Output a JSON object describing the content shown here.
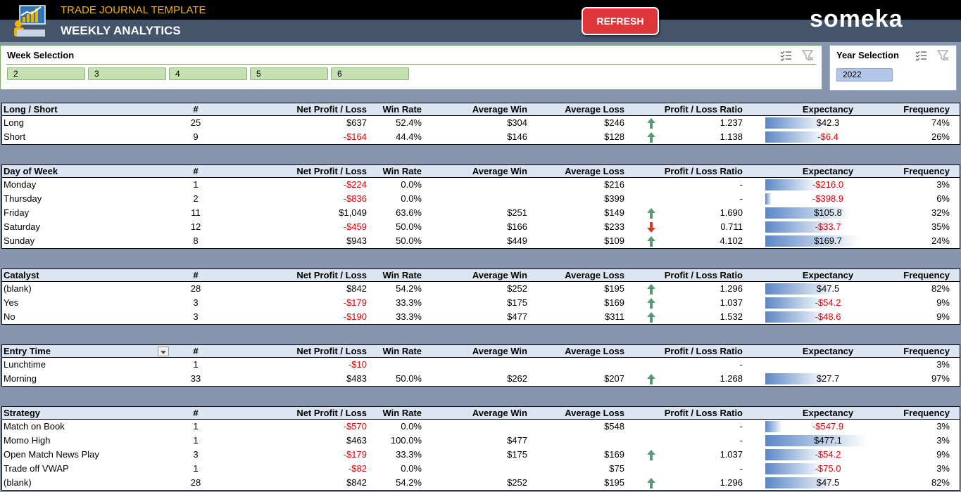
{
  "header": {
    "subtitle": "TRADE JOURNAL TEMPLATE",
    "title": "WEEKLY ANALYTICS",
    "refresh_label": "REFRESH",
    "brand": "someka"
  },
  "week_slicer": {
    "title": "Week Selection",
    "items": [
      "2",
      "3",
      "4",
      "5",
      "6"
    ]
  },
  "year_slicer": {
    "title": "Year Selection",
    "items": [
      "2022"
    ]
  },
  "colors": {
    "positive_arrow": "#5a9a73",
    "negative_arrow": "#d04020",
    "negative_text": "#e00000",
    "bar": "#5b87c7"
  },
  "columns": [
    "#",
    "Net Profit / Loss",
    "Win Rate",
    "Average Win",
    "Average Loss",
    "Profit / Loss Ratio",
    "Expectancy",
    "Frequency"
  ],
  "tables": [
    {
      "title": "Long / Short",
      "rows": [
        {
          "name": "Long",
          "count": "25",
          "np": "$637",
          "np_neg": false,
          "wr": "52.4%",
          "aw": "$304",
          "al": "$246",
          "arrow": "up",
          "plr": "1.237",
          "exp": "$42.3",
          "exp_neg": false,
          "exp_frac": 0.5,
          "freq": "74%"
        },
        {
          "name": "Short",
          "count": "9",
          "np": "-$164",
          "np_neg": true,
          "wr": "44.4%",
          "aw": "$146",
          "al": "$128",
          "arrow": "up",
          "plr": "1.138",
          "exp": "-$6.4",
          "exp_neg": true,
          "exp_frac": 0.5,
          "freq": "26%"
        }
      ]
    },
    {
      "title": "Day of Week",
      "rows": [
        {
          "name": "Monday",
          "count": "1",
          "np": "-$224",
          "np_neg": true,
          "wr": "0.0%",
          "aw": "",
          "al": "$216",
          "arrow": "",
          "plr": "-",
          "exp": "-$216.0",
          "exp_neg": true,
          "exp_frac": 0.44,
          "freq": "3%"
        },
        {
          "name": "Thursday",
          "count": "2",
          "np": "-$836",
          "np_neg": true,
          "wr": "0.0%",
          "aw": "",
          "al": "$399",
          "arrow": "",
          "plr": "-",
          "exp": "-$398.9",
          "exp_neg": true,
          "exp_frac": 0.05,
          "freq": "6%"
        },
        {
          "name": "Friday",
          "count": "11",
          "np": "$1,049",
          "np_neg": false,
          "wr": "63.6%",
          "aw": "$251",
          "al": "$149",
          "arrow": "up",
          "plr": "1.690",
          "exp": "$105.8",
          "exp_neg": false,
          "exp_frac": 0.72,
          "freq": "32%"
        },
        {
          "name": "Saturday",
          "count": "12",
          "np": "-$459",
          "np_neg": true,
          "wr": "50.0%",
          "aw": "$166",
          "al": "$233",
          "arrow": "down",
          "plr": "0.711",
          "exp": "-$33.7",
          "exp_neg": true,
          "exp_frac": 0.6,
          "freq": "35%"
        },
        {
          "name": "Sunday",
          "count": "8",
          "np": "$943",
          "np_neg": false,
          "wr": "50.0%",
          "aw": "$449",
          "al": "$109",
          "arrow": "up",
          "plr": "4.102",
          "exp": "$169.7",
          "exp_neg": false,
          "exp_frac": 0.78,
          "freq": "24%"
        }
      ]
    },
    {
      "title": "Catalyst",
      "rows": [
        {
          "name": "(blank)",
          "count": "28",
          "np": "$842",
          "np_neg": false,
          "wr": "54.2%",
          "aw": "$252",
          "al": "$195",
          "arrow": "up",
          "plr": "1.296",
          "exp": "$47.5",
          "exp_neg": false,
          "exp_frac": 0.59,
          "freq": "82%"
        },
        {
          "name": "Yes",
          "count": "3",
          "np": "-$179",
          "np_neg": true,
          "wr": "33.3%",
          "aw": "$175",
          "al": "$169",
          "arrow": "up",
          "plr": "1.037",
          "exp": "-$54.2",
          "exp_neg": true,
          "exp_frac": 0.5,
          "freq": "9%"
        },
        {
          "name": "No",
          "count": "3",
          "np": "-$190",
          "np_neg": true,
          "wr": "33.3%",
          "aw": "$477",
          "al": "$311",
          "arrow": "up",
          "plr": "1.532",
          "exp": "-$48.6",
          "exp_neg": true,
          "exp_frac": 0.52,
          "freq": "9%"
        }
      ]
    },
    {
      "title": "Entry Time",
      "has_dropdown": true,
      "rows": [
        {
          "name": "Lunchtime",
          "count": "1",
          "np": "-$10",
          "np_neg": true,
          "wr": "",
          "aw": "",
          "al": "",
          "arrow": "",
          "plr": "-",
          "exp": "",
          "exp_neg": false,
          "exp_frac": 0,
          "freq": "3%"
        },
        {
          "name": "Morning",
          "count": "33",
          "np": "$483",
          "np_neg": false,
          "wr": "50.0%",
          "aw": "$262",
          "al": "$207",
          "arrow": "up",
          "plr": "1.268",
          "exp": "$27.7",
          "exp_neg": false,
          "exp_frac": 0.5,
          "freq": "97%"
        }
      ]
    },
    {
      "title": "Strategy",
      "rows": [
        {
          "name": "Match on Book",
          "count": "1",
          "np": "-$570",
          "np_neg": true,
          "wr": "0.0%",
          "aw": "",
          "al": "$548",
          "arrow": "",
          "plr": "-",
          "exp": "-$547.9",
          "exp_neg": true,
          "exp_frac": 0.14,
          "freq": "3%"
        },
        {
          "name": "Momo High",
          "count": "1",
          "np": "$463",
          "np_neg": false,
          "wr": "100.0%",
          "aw": "$477",
          "al": "",
          "arrow": "",
          "plr": "-",
          "exp": "$477.1",
          "exp_neg": false,
          "exp_frac": 0.85,
          "freq": "3%"
        },
        {
          "name": "Open Match News Play",
          "count": "3",
          "np": "-$179",
          "np_neg": true,
          "wr": "33.3%",
          "aw": "$175",
          "al": "$169",
          "arrow": "up",
          "plr": "1.037",
          "exp": "-$54.2",
          "exp_neg": true,
          "exp_frac": 0.5,
          "freq": "9%"
        },
        {
          "name": "Trade off VWAP",
          "count": "1",
          "np": "-$82",
          "np_neg": true,
          "wr": "0.0%",
          "aw": "",
          "al": "$75",
          "arrow": "",
          "plr": "-",
          "exp": "-$75.0",
          "exp_neg": true,
          "exp_frac": 0.48,
          "freq": "3%"
        },
        {
          "name": "(blank)",
          "count": "28",
          "np": "$842",
          "np_neg": false,
          "wr": "54.2%",
          "aw": "$252",
          "al": "$195",
          "arrow": "up",
          "plr": "1.296",
          "exp": "$47.5",
          "exp_neg": false,
          "exp_frac": 0.59,
          "freq": "82%"
        }
      ]
    }
  ]
}
